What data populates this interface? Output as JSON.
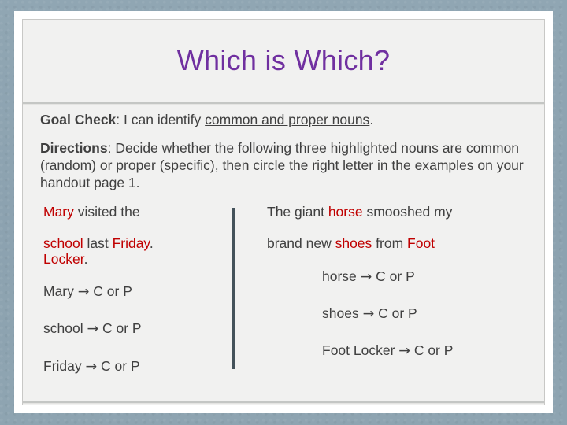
{
  "slide": {
    "title": "Which is Which?",
    "title_color": "#7030a0",
    "highlight_color": "#c00000",
    "text_color": "#404040",
    "background_color": "#f1f1f0",
    "mat_color": "#8ca2b0",
    "divider_color": "#44525a"
  },
  "goal": {
    "label": "Goal Check",
    "colon": ": ",
    "lead": "I can identify ",
    "underlined": "common and proper nouns",
    "end": "."
  },
  "directions": {
    "label": "Directions",
    "colon": ": ",
    "text": "Decide whether the following three highlighted nouns are common (random) or proper (specific), then circle the right letter in the examples on your handout page 1."
  },
  "examples": {
    "left": {
      "sentence_line1": [
        {
          "text": "Mary",
          "highlight": true
        },
        {
          "text": " visited the",
          "highlight": false
        }
      ],
      "sentence_line2": [
        {
          "text": "school",
          "highlight": true
        },
        {
          "text": " last ",
          "highlight": false
        },
        {
          "text": "Friday",
          "highlight": true
        },
        {
          "text": ".",
          "highlight": false
        }
      ],
      "sentence_line3": [
        {
          "text": "Locker",
          "highlight": true
        },
        {
          "text": ".",
          "highlight": false
        }
      ],
      "answers": [
        {
          "noun": "Mary",
          "arrow": "→",
          "choices": "C or P"
        },
        {
          "noun": "school",
          "arrow": "→",
          "choices": "C or P"
        },
        {
          "noun": "Friday",
          "arrow": "→",
          "choices": "C or P"
        }
      ]
    },
    "right": {
      "sentence_line1": [
        {
          "text": "The giant ",
          "highlight": false
        },
        {
          "text": "horse",
          "highlight": true
        },
        {
          "text": " smooshed my",
          "highlight": false
        }
      ],
      "sentence_line2": [
        {
          "text": "brand new ",
          "highlight": false
        },
        {
          "text": "shoes",
          "highlight": true
        },
        {
          "text": " from ",
          "highlight": false
        },
        {
          "text": "Foot",
          "highlight": true
        }
      ],
      "answers": [
        {
          "noun": "horse",
          "arrow": "→",
          "choices": "C or P"
        },
        {
          "noun": "shoes",
          "arrow": "→",
          "choices": "C or P"
        },
        {
          "noun": "Foot Locker",
          "arrow": "→",
          "choices": "C or P"
        }
      ]
    }
  }
}
